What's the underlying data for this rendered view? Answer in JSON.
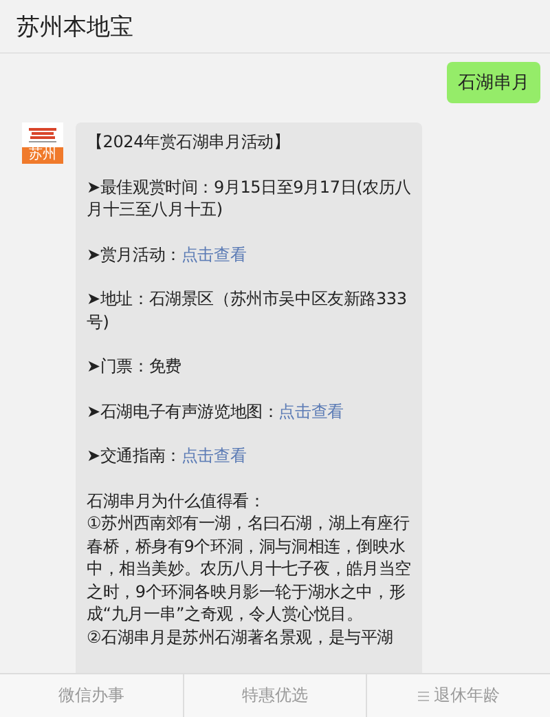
{
  "header": {
    "title": "苏州本地宝"
  },
  "messages": [
    {
      "kind": "sent",
      "text": "石湖串月"
    },
    {
      "kind": "received",
      "avatar_label": "苏州",
      "paragraphs": [
        {
          "lines": [
            {
              "text": "【2024年赏石湖串月活动】"
            }
          ]
        },
        {
          "lines": [
            {
              "text": "➤最佳观赏时间：9月15日至9月17日(农历八月十三至八月十五)"
            }
          ]
        },
        {
          "lines": [
            {
              "text": "➤赏月活动：",
              "link": "点击查看"
            }
          ]
        },
        {
          "lines": [
            {
              "text": "➤地址：石湖景区（苏州市吴中区友新路333号)"
            }
          ]
        },
        {
          "lines": [
            {
              "text": "➤门票：免费"
            }
          ]
        },
        {
          "lines": [
            {
              "text": "➤石湖电子有声游览地图：",
              "link": "点击查看"
            }
          ]
        },
        {
          "lines": [
            {
              "text": "➤交通指南：",
              "link": "点击查看"
            }
          ]
        },
        {
          "lines": [
            {
              "text": "石湖串月为什么值得看："
            },
            {
              "text": "①苏州西南郊有一湖，名曰石湖，湖上有座行春桥，桥身有9个环洞，洞与洞相连，倒映水中，相当美妙。农历八月十七子夜，皓月当空之时，9个环洞各映月影一轮于湖水之中，形成“九月一串”之奇观，令人赏心悦目。"
            },
            {
              "text": "②石湖串月是苏州石湖著名景观，是与平湖"
            }
          ]
        }
      ]
    }
  ],
  "bottom_menu": [
    {
      "label": "微信办事",
      "has_menu_icon": false
    },
    {
      "label": "特惠优选",
      "has_menu_icon": false
    },
    {
      "label": "退休年龄",
      "has_menu_icon": true
    }
  ]
}
